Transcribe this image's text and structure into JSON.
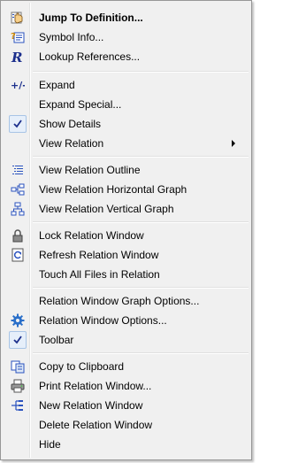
{
  "menu": {
    "items": [
      {
        "label": "Jump To Definition...",
        "icon": "jump-to-definition-icon"
      },
      {
        "label": "Symbol Info...",
        "icon": "symbol-info-icon"
      },
      {
        "label": "Lookup References...",
        "icon": "lookup-references-icon"
      },
      {
        "label": "Expand",
        "icon": "plus-minus-icon"
      },
      {
        "label": "Expand Special..."
      },
      {
        "label": "Show Details",
        "checked": true
      },
      {
        "label": "View Relation",
        "submenu": true
      },
      {
        "label": "View Relation Outline",
        "icon": "outline-view-icon"
      },
      {
        "label": "View Relation Horizontal Graph",
        "icon": "horizontal-graph-icon"
      },
      {
        "label": "View Relation Vertical Graph",
        "icon": "vertical-graph-icon"
      },
      {
        "label": "Lock Relation Window",
        "icon": "lock-icon"
      },
      {
        "label": "Refresh Relation Window",
        "icon": "refresh-icon"
      },
      {
        "label": "Touch All Files in Relation"
      },
      {
        "label": "Relation Window Graph Options..."
      },
      {
        "label": "Relation Window Options...",
        "icon": "gear-icon"
      },
      {
        "label": "Toolbar",
        "checked": true
      },
      {
        "label": "Copy to Clipboard",
        "icon": "copy-icon"
      },
      {
        "label": "Print Relation Window...",
        "icon": "printer-icon"
      },
      {
        "label": "New Relation Window",
        "icon": "new-window-icon"
      },
      {
        "label": "Delete Relation Window"
      },
      {
        "label": "Hide"
      }
    ]
  },
  "colors": {
    "menu_background": "#f0f0f0",
    "border": "#979797",
    "check_background": "#e6effa",
    "check_border": "#a8c4e6",
    "icon_blue": "#2a52be"
  }
}
